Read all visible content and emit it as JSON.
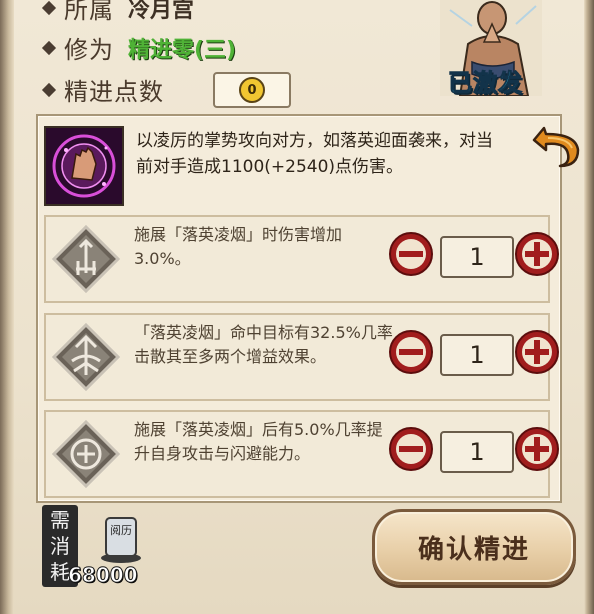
{
  "header": {
    "faction_label": "所属",
    "faction_value": "冷月宫",
    "cultivation_label": "修为",
    "cultivation_value": "精进零(三)",
    "points_label": "精进点数",
    "points_value": "0"
  },
  "character": {
    "status_label": "已激发",
    "status_color": "#33c3e6"
  },
  "skill": {
    "icon": "palm-strike-icon",
    "description": "以凌厉的掌势攻向对方，如落英迎面袭来，对当前对手造成1100(+2540)点伤害。"
  },
  "upgrades": [
    {
      "icon": "sword-up-icon",
      "text": "施展「落英凌烟」时伤害增加3.0%。",
      "count": "1"
    },
    {
      "icon": "dispel-icon",
      "text": "「落英凌烟」命中目标有32.5%几率击散其至多两个增益效果。",
      "count": "1"
    },
    {
      "icon": "shield-plus-icon",
      "text": "施展「落英凌烟」后有5.0%几率提升自身攻击与闪避能力。",
      "count": "1"
    }
  ],
  "footer": {
    "need_label": [
      "需",
      "消",
      "耗"
    ],
    "currency_label": "阅历",
    "cost_value": "68000",
    "confirm_label": "确认精进"
  },
  "colors": {
    "accent_red": "#9e1b1b",
    "cultivation_green": "#4fb236",
    "panel_bg": "#f4ecdb"
  }
}
